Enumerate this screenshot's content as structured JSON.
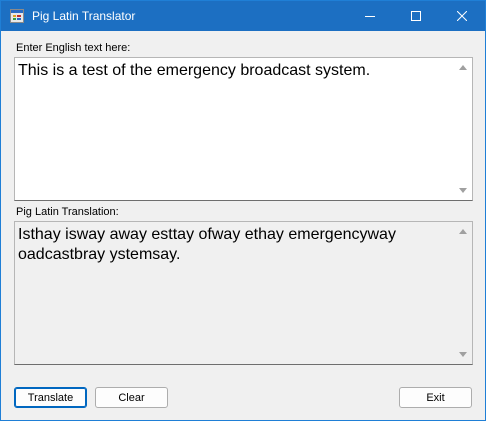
{
  "window": {
    "title": "Pig Latin Translator",
    "icon": "app-form-icon",
    "controls": {
      "minimize_icon": "minimize-icon",
      "maximize_icon": "maximize-icon",
      "close_icon": "close-icon"
    },
    "accent_color": "#1c6fc2"
  },
  "input": {
    "label": "Enter English text here:",
    "value": "This is a test of the emergency broadcast system."
  },
  "output": {
    "label": "Pig Latin Translation:",
    "value": "Isthay isway away esttay ofway ethay emergencyway oadcastbray ystemsay."
  },
  "buttons": {
    "translate": "Translate",
    "clear": "Clear",
    "exit": "Exit"
  }
}
